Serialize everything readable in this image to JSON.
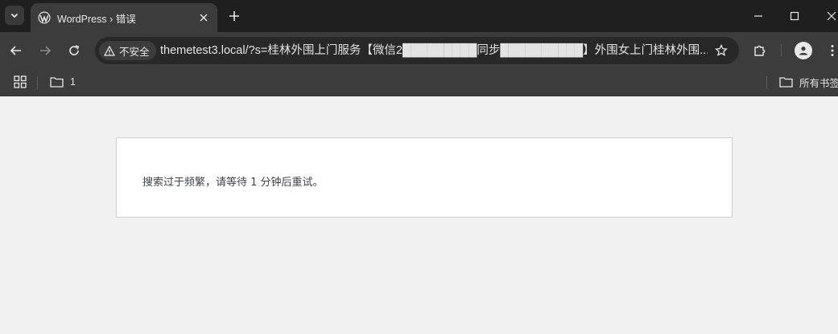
{
  "tab": {
    "title": "WordPress › 错误"
  },
  "omnibox": {
    "security_label": "不安全",
    "url": "themetest3.local/?s=桂林外围上门服务【微信2█████████同步██████████】外围女上门桂林外围..."
  },
  "bookmarks": {
    "folder_label": "1",
    "all_bookmarks_label": "所有书签"
  },
  "page": {
    "error_message": "搜索过于频繁，请等待 1 分钟后重试。"
  }
}
